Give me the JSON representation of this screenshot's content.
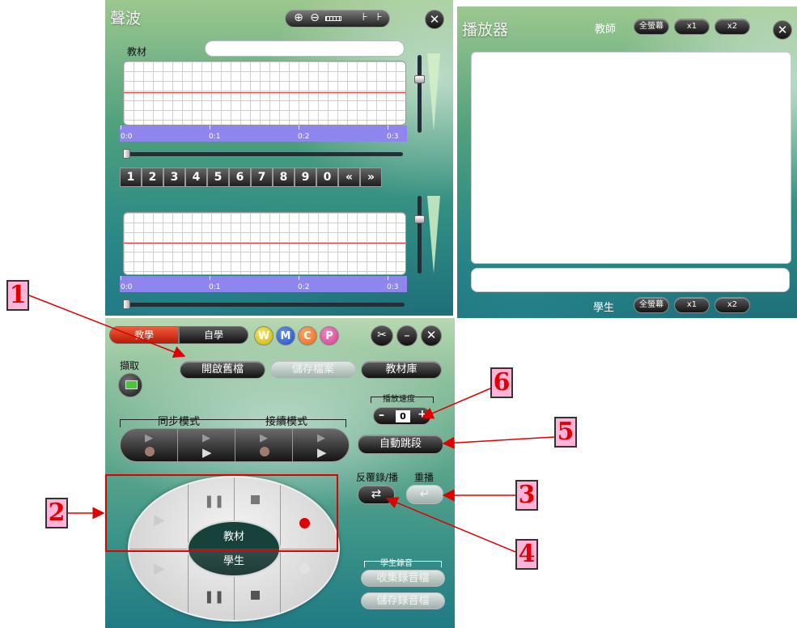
{
  "waveform_panel": {
    "title": "聲波",
    "material_label": "教材",
    "top_timeline_ticks": [
      "0:0",
      "0:1",
      "0:2",
      "0:3"
    ],
    "bottom_timeline_ticks": [
      "0:0",
      "0:1",
      "0:2",
      "0:3"
    ],
    "number_keys": [
      "1",
      "2",
      "3",
      "4",
      "5",
      "6",
      "7",
      "8",
      "9",
      "0",
      "«",
      "»"
    ],
    "toolbar_icons": [
      "zoom-in-icon",
      "zoom-out-icon",
      "ruler-icon",
      "mark-start-icon",
      "mark-end-icon"
    ],
    "close_label": "✕"
  },
  "player_panel": {
    "title": "播放器",
    "teacher_label": "教師",
    "student_label": "學生",
    "fullscreen_label": "全螢幕",
    "x1_label": "x1",
    "x2_label": "x2",
    "close_label": "✕"
  },
  "control_panel": {
    "tab_teach": "教學",
    "tab_self": "自學",
    "letter_buttons": [
      {
        "label": "W",
        "color": "#c9b400"
      },
      {
        "label": "M",
        "color": "#1f4fbf"
      },
      {
        "label": "C",
        "color": "#e06a1a"
      },
      {
        "label": "P",
        "color": "#d23b8c"
      }
    ],
    "capture_label": "擷取",
    "open_file_label": "開啟舊檔",
    "save_file_label": "儲存檔案",
    "library_label": "教材庫",
    "speed_label": "播放速度",
    "speed_value": "0",
    "sync_mode_label": "同步模式",
    "relay_mode_label": "接續模式",
    "auto_skip_label": "自動跳段",
    "repeat_label": "反覆錄/播",
    "replay_label": "重播",
    "material_center_label": "教材",
    "student_center_label": "學生",
    "student_record_label": "學生錄音",
    "collect_label": "收集錄音檔",
    "save_record_label": "儲存錄音檔"
  },
  "callouts": [
    "1",
    "2",
    "3",
    "4",
    "5",
    "6"
  ],
  "colors": {
    "accent_red": "#e00000",
    "callout_bg": "#ffb3d9",
    "timeline": "#8e86ee",
    "active_tab": "#d42b14"
  }
}
